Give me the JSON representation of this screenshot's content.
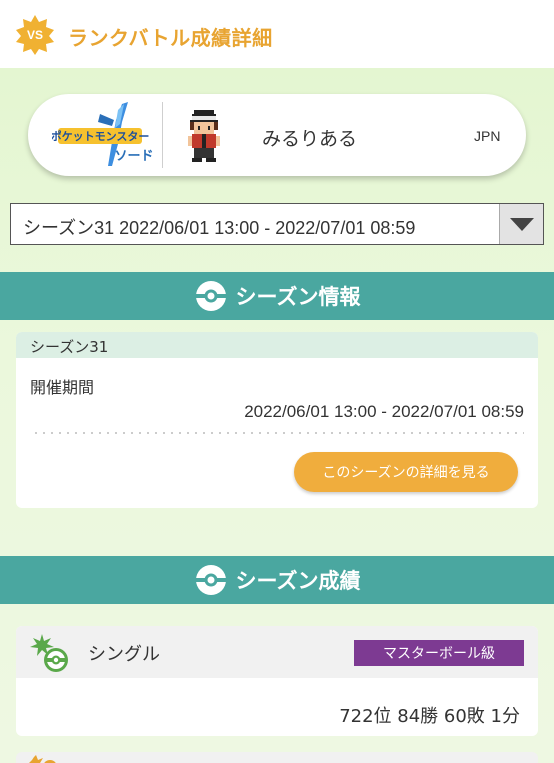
{
  "header": {
    "badge_text": "VS",
    "title": "ランクバトル成績詳細",
    "accent_color": "#e8a431"
  },
  "profile": {
    "game_logo_icon": "pokemon-sword-logo",
    "game_logo_text_top": "ポケットモンスター",
    "game_logo_text_bottom": "ソード",
    "avatar_icon": "trainer-sprite-icon",
    "player_name": "みるりある",
    "region": "JPN"
  },
  "season_select": {
    "selected": "シーズン31 2022/06/01 13:00 - 2022/07/01 08:59"
  },
  "season_info": {
    "section_title": "シーズン情報",
    "card_title": "シーズン31",
    "period_label": "開催期間",
    "period_value": "2022/06/01 13:00 - 2022/07/01 08:59",
    "detail_button_label": "このシーズンの詳細を見る"
  },
  "season_results": {
    "section_title": "シーズン成績",
    "records": [
      {
        "format": "シングル",
        "rank_class": "マスターボール級",
        "result": "722位 84勝 60敗 1分"
      }
    ]
  },
  "colors": {
    "section_band": "#4aa7a0",
    "button": "#f0ad3d",
    "rank_badge": "#7d3a92",
    "background_green": "#e4f6d1"
  }
}
